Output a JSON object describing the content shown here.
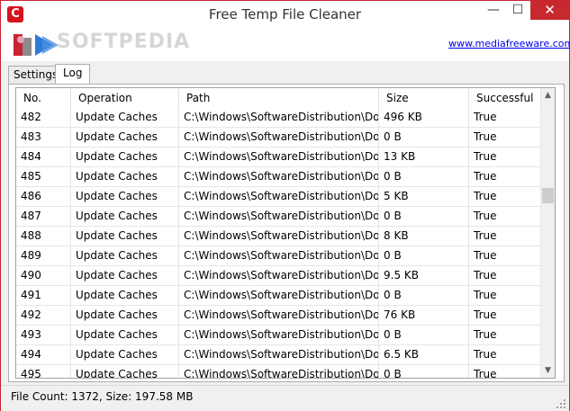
{
  "window": {
    "title": "Free Temp File Cleaner",
    "app_icon_letter": "C",
    "minimize_glyph": "—",
    "maximize_glyph": "☐",
    "close_glyph": "✕"
  },
  "toolbar": {
    "watermark": "SOFTPEDIA",
    "site_link": "www.mediafreeware.com"
  },
  "tabs": [
    {
      "label": "Settings",
      "active": false
    },
    {
      "label": "Log",
      "active": true
    }
  ],
  "table": {
    "columns": [
      "No.",
      "Operation",
      "Path",
      "Size",
      "Successful"
    ],
    "rows": [
      [
        "482",
        "Update Caches",
        "C:\\Windows\\SoftwareDistribution\\Downloa...",
        "496 KB",
        "True"
      ],
      [
        "483",
        "Update Caches",
        "C:\\Windows\\SoftwareDistribution\\Downloa...",
        "0 B",
        "True"
      ],
      [
        "484",
        "Update Caches",
        "C:\\Windows\\SoftwareDistribution\\Downloa...",
        "13 KB",
        "True"
      ],
      [
        "485",
        "Update Caches",
        "C:\\Windows\\SoftwareDistribution\\Downloa...",
        "0 B",
        "True"
      ],
      [
        "486",
        "Update Caches",
        "C:\\Windows\\SoftwareDistribution\\Downloa...",
        "5 KB",
        "True"
      ],
      [
        "487",
        "Update Caches",
        "C:\\Windows\\SoftwareDistribution\\Downloa...",
        "0 B",
        "True"
      ],
      [
        "488",
        "Update Caches",
        "C:\\Windows\\SoftwareDistribution\\Downloa...",
        "8 KB",
        "True"
      ],
      [
        "489",
        "Update Caches",
        "C:\\Windows\\SoftwareDistribution\\Downloa...",
        "0 B",
        "True"
      ],
      [
        "490",
        "Update Caches",
        "C:\\Windows\\SoftwareDistribution\\Downloa...",
        "9.5 KB",
        "True"
      ],
      [
        "491",
        "Update Caches",
        "C:\\Windows\\SoftwareDistribution\\Downloa...",
        "0 B",
        "True"
      ],
      [
        "492",
        "Update Caches",
        "C:\\Windows\\SoftwareDistribution\\Downloa...",
        "76 KB",
        "True"
      ],
      [
        "493",
        "Update Caches",
        "C:\\Windows\\SoftwareDistribution\\Downloa...",
        "0 B",
        "True"
      ],
      [
        "494",
        "Update Caches",
        "C:\\Windows\\SoftwareDistribution\\Downloa...",
        "6.5 KB",
        "True"
      ],
      [
        "495",
        "Update Caches",
        "C:\\Windows\\SoftwareDistribution\\Downloa...",
        "0 B",
        "True"
      ]
    ]
  },
  "status": {
    "text": "File Count: 1372, Size: 197.58 MB"
  },
  "colors": {
    "accent": "#c8242f",
    "close_button": "#c7292e",
    "link": "#0000ee"
  }
}
